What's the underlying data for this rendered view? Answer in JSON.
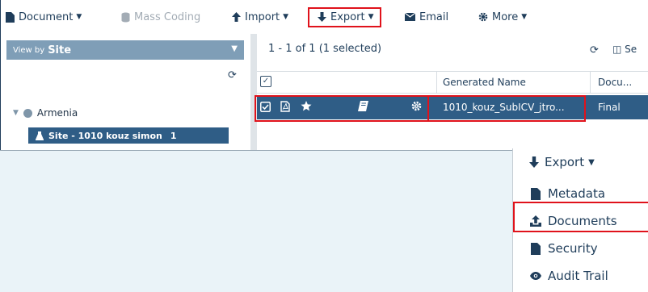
{
  "toolbar": {
    "document": "Document",
    "mass_coding": "Mass Coding",
    "import": "Import",
    "export": "Export",
    "email": "Email",
    "more": "More"
  },
  "left_panel": {
    "view_by_prefix": "View by",
    "view_by_value": "Site",
    "tree_root": "Armenia",
    "site_item": "Site - 1010 kouz simon",
    "site_count": "1"
  },
  "grid": {
    "pager": "1 - 1 of 1 (1 selected)",
    "select_button": "Se",
    "columns": [
      "Generated Name",
      "Docu..."
    ],
    "rows": [
      {
        "generated_name": "1010_kouz_SubICV_jtro...",
        "status": "Final"
      }
    ]
  },
  "export_menu": {
    "header": "Export",
    "items": [
      "Metadata",
      "Documents",
      "Security",
      "Audit Trail"
    ]
  },
  "colors": {
    "accent": "#2f5d86",
    "highlight": "#e0121b",
    "view_by_bar": "#7f9eb7"
  }
}
